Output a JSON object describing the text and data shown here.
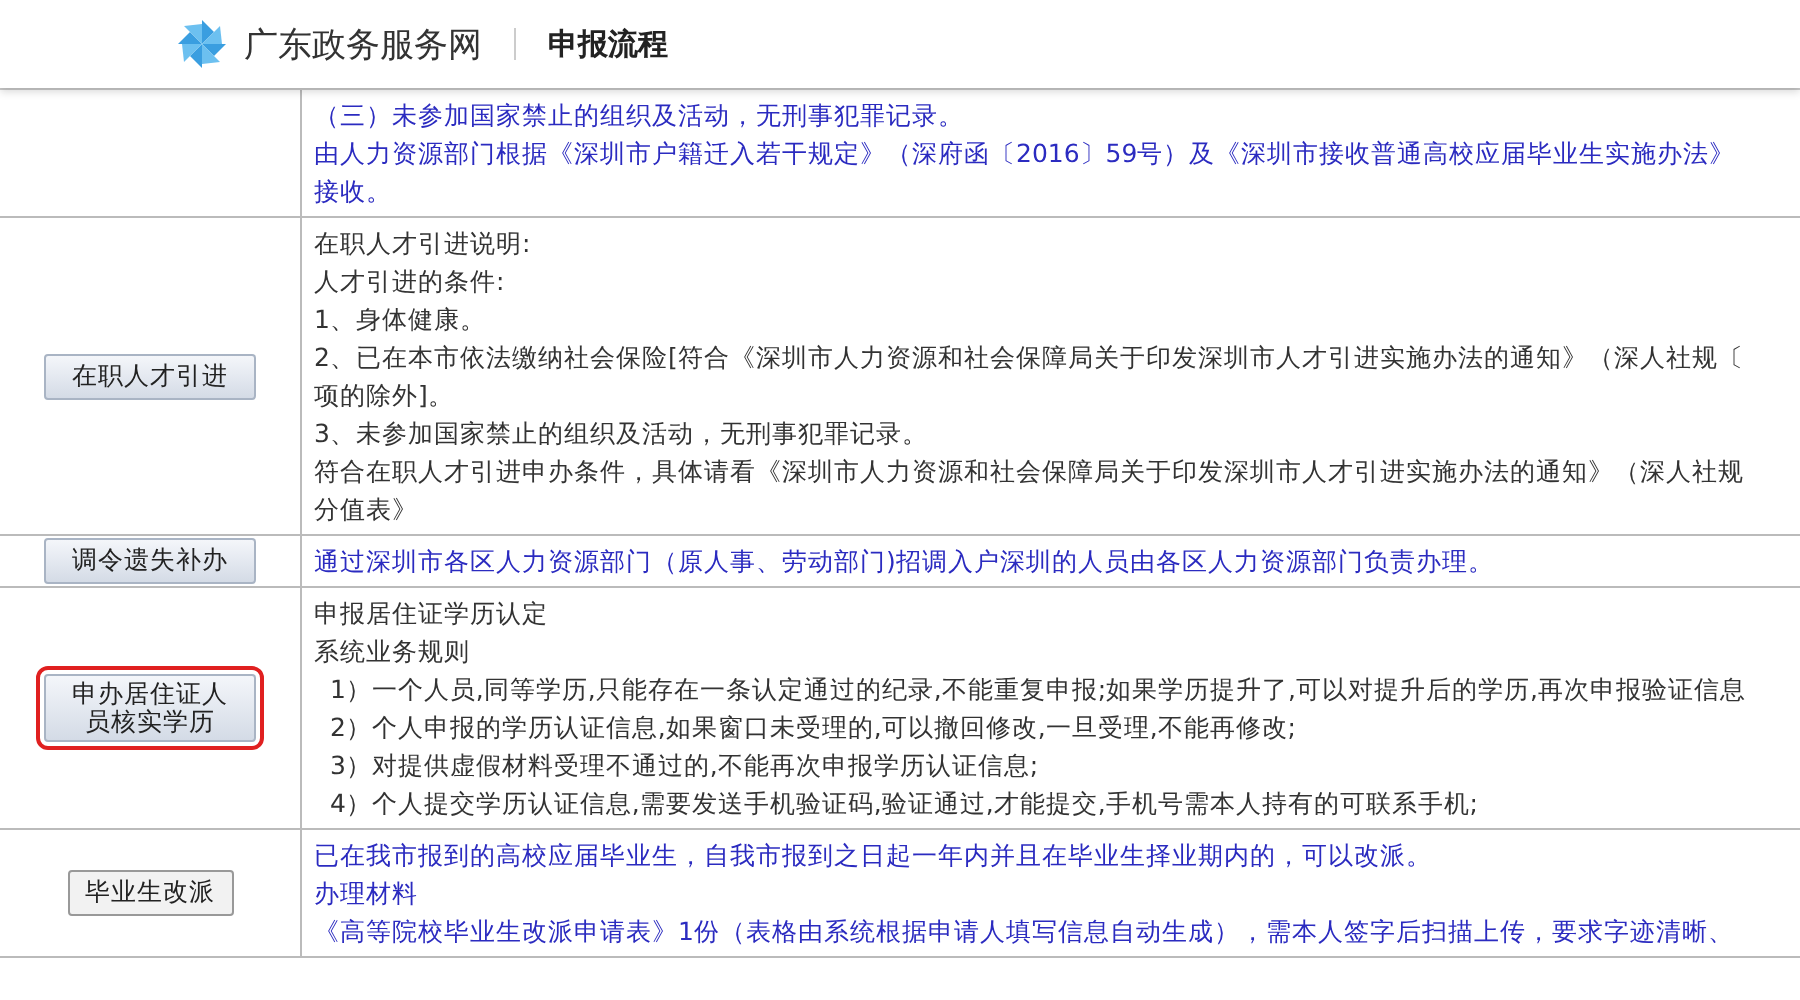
{
  "header": {
    "site_name": "广东政务服务网",
    "page_title": "申报流程"
  },
  "rows": [
    {
      "button": null,
      "color": "#2b2bc0",
      "lines": [
        "（三）未参加国家禁止的组织及活动，无刑事犯罪记录。",
        "由人力资源部门根据《深圳市户籍迁入若干规定》（深府函〔2016〕59号）及《深圳市接收普通高校应届毕业生实施办法》",
        "接收。"
      ]
    },
    {
      "button": {
        "label": "在职人才引进",
        "kind": "gradient",
        "highlighted": false
      },
      "color": "#333333",
      "lines": [
        "在职人才引进说明:",
        "人才引进的条件:",
        "1、身体健康。",
        "2、已在本市依法缴纳社会保险[符合《深圳市人力资源和社会保障局关于印发深圳市人才引进实施办法的通知》（深人社规〔",
        "项的除外]。",
        "3、未参加国家禁止的组织及活动，无刑事犯罪记录。",
        "符合在职人才引进申办条件，具体请看《深圳市人力资源和社会保障局关于印发深圳市人才引进实施办法的通知》（深人社规",
        "分值表》"
      ]
    },
    {
      "button": {
        "label": "调令遗失补办",
        "kind": "gradient",
        "highlighted": false
      },
      "color": "#2b2bc0",
      "lines": [
        "通过深圳市各区人力资源部门（原人事、劳动部门)招调入户深圳的人员由各区人力资源部门负责办理。"
      ]
    },
    {
      "button": {
        "label": "申办居住证人员核实学历",
        "kind": "gradient",
        "highlighted": true
      },
      "color": "#333333",
      "lines": [
        "申报居住证学历认定",
        "系统业务规则",
        "  1）一个人员,同等学历,只能存在一条认定通过的纪录,不能重复申报;如果学历提升了,可以对提升后的学历,再次申报验证信息",
        "  2）个人申报的学历认证信息,如果窗口未受理的,可以撤回修改,一旦受理,不能再修改;",
        "  3）对提供虚假材料受理不通过的,不能再次申报学历认证信息;",
        "  4）个人提交学历认证信息,需要发送手机验证码,验证通过,才能提交,手机号需本人持有的可联系手机;"
      ]
    },
    {
      "button": {
        "label": "毕业生改派",
        "kind": "plain",
        "highlighted": false
      },
      "color": "#2b2bc0",
      "lines": [
        "已在我市报到的高校应届毕业生，自我市报到之日起一年内并且在毕业生择业期内的，可以改派。",
        "办理材料",
        "《高等院校毕业生改派申请表》1份（表格由系统根据申请人填写信息自动生成），需本人签字后扫描上传，要求字迹清晰、"
      ]
    }
  ]
}
